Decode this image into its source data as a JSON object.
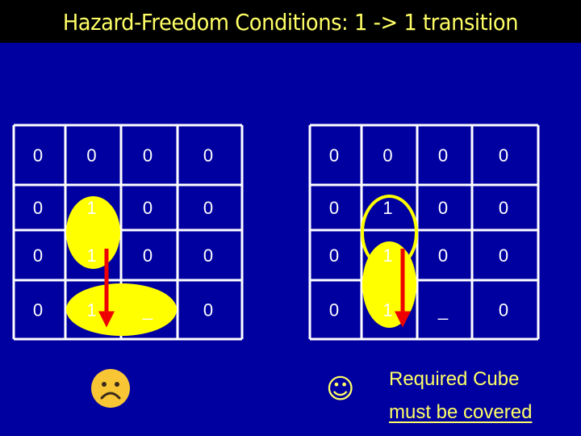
{
  "title": "Hazard-Freedom Conditions: 1 -> 1 transition",
  "colors": {
    "background": "#0000A0",
    "header": "#000000",
    "title_text": "#FFFF66",
    "grid_line": "#FFFFFF",
    "cell_text": "#FFFFFF",
    "cube_fill": "#FFFF00",
    "arrow": "#EE0000"
  },
  "kmaps": [
    {
      "name": "left",
      "cells": [
        [
          "0",
          "0",
          "0",
          "0"
        ],
        [
          "0",
          "1",
          "0",
          "0"
        ],
        [
          "0",
          "1",
          "0",
          "0"
        ],
        [
          "0",
          "1",
          "_",
          "0"
        ]
      ],
      "cubes": [
        {
          "style": "filled",
          "cells": [
            [
              1,
              1
            ],
            [
              2,
              1
            ]
          ]
        },
        {
          "style": "filled",
          "cells": [
            [
              3,
              1
            ],
            [
              3,
              2
            ]
          ]
        }
      ],
      "transition": {
        "from": [
          2,
          1
        ],
        "to": [
          3,
          1
        ]
      },
      "verdict_icon": "frown-face-icon"
    },
    {
      "name": "right",
      "cells": [
        [
          "0",
          "0",
          "0",
          "0"
        ],
        [
          "0",
          "1",
          "0",
          "0"
        ],
        [
          "0",
          "1",
          "0",
          "0"
        ],
        [
          "0",
          "1",
          "_",
          "0"
        ]
      ],
      "cubes": [
        {
          "style": "outline",
          "cells": [
            [
              1,
              1
            ],
            [
              2,
              1
            ]
          ]
        },
        {
          "style": "filled",
          "cells": [
            [
              2,
              1
            ],
            [
              3,
              1
            ]
          ]
        }
      ],
      "transition": {
        "from": [
          2,
          1
        ],
        "to": [
          3,
          1
        ]
      },
      "verdict_icon": "smile-face-icon"
    }
  ],
  "verdicts": {
    "left_symbol": "☹",
    "right_symbol": "☺"
  },
  "note": {
    "line1": "Required Cube",
    "line2": "must be covered"
  }
}
